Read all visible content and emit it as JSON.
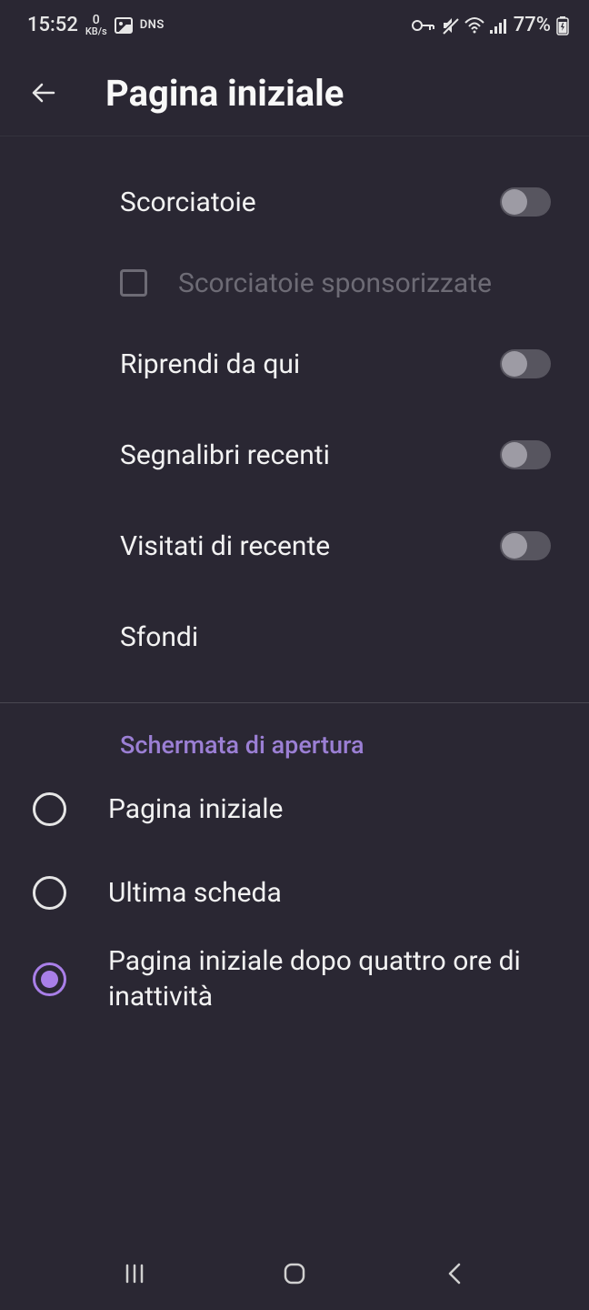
{
  "status": {
    "time": "15:52",
    "kb_top": "0",
    "kb_bot": "KB/s",
    "dns": "DNS",
    "battery": "77%"
  },
  "header": {
    "title": "Pagina iniziale"
  },
  "settings": {
    "shortcuts": "Scorciatoie",
    "sponsored": "Scorciatoie sponsorizzate",
    "resume": "Riprendi da qui",
    "bookmarks": "Segnalibri recenti",
    "recent": "Visitati di recente",
    "wallpapers": "Sfondi"
  },
  "opening": {
    "section": "Schermata di apertura",
    "opt1": "Pagina iniziale",
    "opt2": "Ultima scheda",
    "opt3": "Pagina iniziale dopo quattro ore di inattività"
  }
}
